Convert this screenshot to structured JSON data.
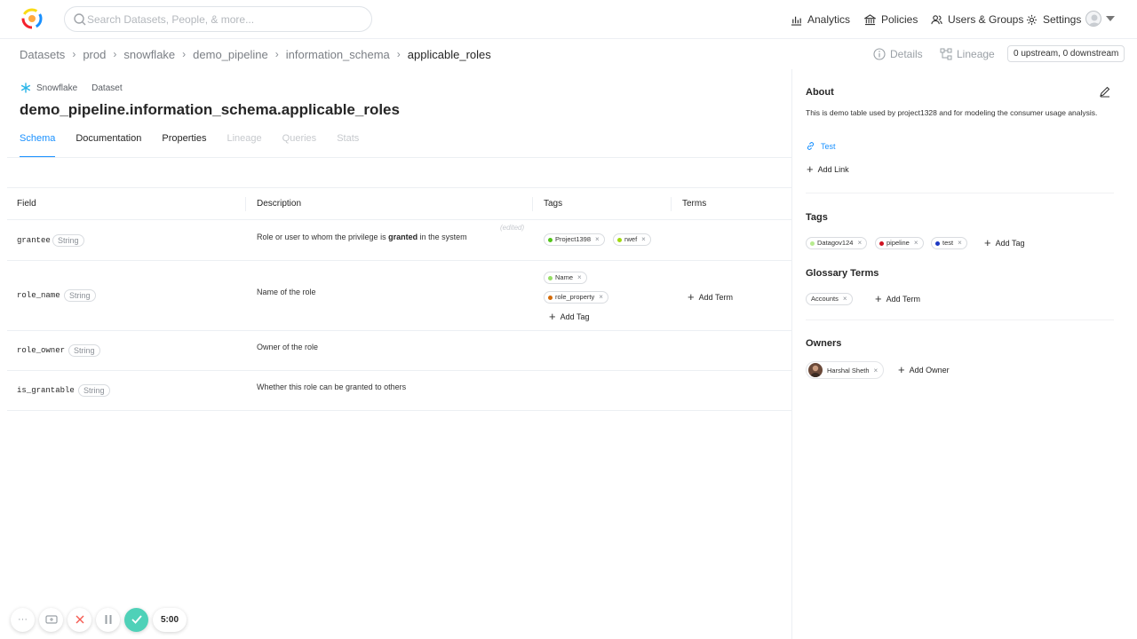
{
  "header": {
    "search_placeholder": "Search Datasets, People, & more...",
    "nav": [
      {
        "label": "Analytics",
        "icon": "bar-chart-icon"
      },
      {
        "label": "Policies",
        "icon": "bank-icon"
      },
      {
        "label": "Users & Groups",
        "icon": "users-icon"
      },
      {
        "label": "Settings",
        "icon": "gear-icon"
      }
    ]
  },
  "breadcrumb": [
    "Datasets",
    "prod",
    "snowflake",
    "demo_pipeline",
    "information_schema",
    "applicable_roles"
  ],
  "toolbar": {
    "details_label": "Details",
    "lineage_label": "Lineage",
    "updown_label": "0 upstream, 0 downstream"
  },
  "entity": {
    "platform": "Snowflake",
    "type": "Dataset",
    "title": "demo_pipeline.information_schema.applicable_roles",
    "tabs": [
      {
        "label": "Schema",
        "state": "active"
      },
      {
        "label": "Documentation",
        "state": "normal"
      },
      {
        "label": "Properties",
        "state": "normal"
      },
      {
        "label": "Lineage",
        "state": "disabled"
      },
      {
        "label": "Queries",
        "state": "disabled"
      },
      {
        "label": "Stats",
        "state": "disabled"
      }
    ]
  },
  "schema": {
    "columns": [
      "Field",
      "Description",
      "Tags",
      "Terms"
    ],
    "rows": [
      {
        "field": "grantee",
        "type": "String",
        "desc_before": "Role or user to whom the privilege is ",
        "desc_bold": "granted",
        "desc_after": " in the system",
        "edited": "(edited)",
        "tags": [
          {
            "label": "Project1398",
            "color": "#52c41a"
          },
          {
            "label": "rwef",
            "color": "#a0d911"
          }
        ]
      },
      {
        "field": "role_name",
        "type": "String",
        "desc": "Name of the role",
        "tags": [
          {
            "label": "Name",
            "color": "#95de64"
          },
          {
            "label": "role_property",
            "color": "#d46b08"
          }
        ],
        "add_tag": "Add Tag",
        "add_term": "Add Term"
      },
      {
        "field": "role_owner",
        "type": "String",
        "desc": "Owner of the role"
      },
      {
        "field": "is_grantable",
        "type": "String",
        "desc": "Whether this role can be granted to others"
      }
    ]
  },
  "sidebar": {
    "about_heading": "About",
    "about_text": "This is demo table used by project1328 and for modeling the consumer usage analysis.",
    "link_label": "Test",
    "add_link": "Add Link",
    "tags_heading": "Tags",
    "tags": [
      {
        "label": "Datagov124",
        "color": "#b7eb8f"
      },
      {
        "label": "pipeline",
        "color": "#cf1322"
      },
      {
        "label": "test",
        "color": "#1d39c4"
      }
    ],
    "add_tag": "Add Tag",
    "terms_heading": "Glossary Terms",
    "terms": [
      {
        "label": "Accounts"
      }
    ],
    "add_term": "Add Term",
    "owners_heading": "Owners",
    "owners": [
      {
        "name": "Harshal Sheth"
      }
    ],
    "add_owner": "Add Owner"
  },
  "recorder": {
    "time": "5:00"
  },
  "colors": {
    "accent": "#1890ff",
    "record_ok": "#4fd1b8"
  }
}
